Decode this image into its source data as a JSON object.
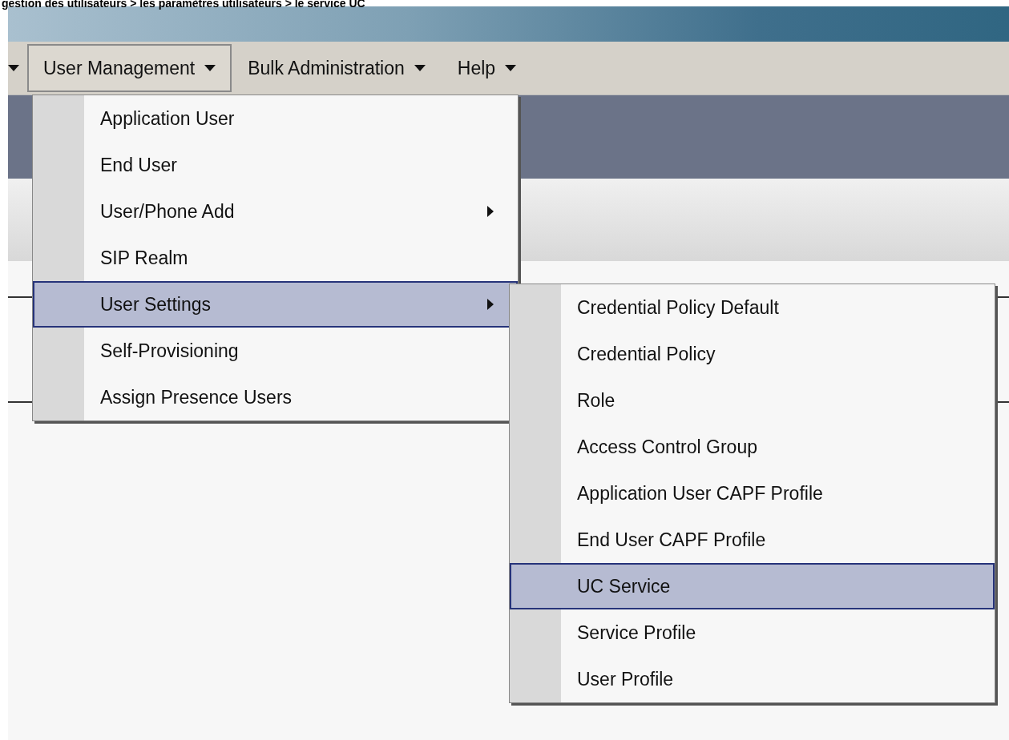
{
  "caption": "gestion des utilisateurs > les paramètres utilisateurs > le service UC",
  "menubar": [
    {
      "label": "User Management",
      "selected": true
    },
    {
      "label": "Bulk Administration",
      "selected": false
    },
    {
      "label": "Help",
      "selected": false
    }
  ],
  "menu": [
    {
      "label": "Application User",
      "selected": false
    },
    {
      "label": "End User",
      "selected": false
    },
    {
      "label": "User/Phone Add",
      "selected": false,
      "has_submenu": true
    },
    {
      "label": "SIP Realm",
      "selected": false
    },
    {
      "label": "User Settings",
      "selected": true,
      "has_submenu": true,
      "children": [
        {
          "label": "Credential Policy Default",
          "selected": false
        },
        {
          "label": "Credential Policy",
          "selected": false
        },
        {
          "label": "Role",
          "selected": false
        },
        {
          "label": "Access Control Group",
          "selected": false
        },
        {
          "label": "Application User CAPF Profile",
          "selected": false
        },
        {
          "label": "End User CAPF Profile",
          "selected": false
        },
        {
          "label": "UC Service",
          "selected": true
        },
        {
          "label": "Service Profile",
          "selected": false
        },
        {
          "label": "User Profile",
          "selected": false
        }
      ]
    },
    {
      "label": "Self-Provisioning",
      "selected": false
    },
    {
      "label": "Assign Presence Users",
      "selected": false
    }
  ]
}
